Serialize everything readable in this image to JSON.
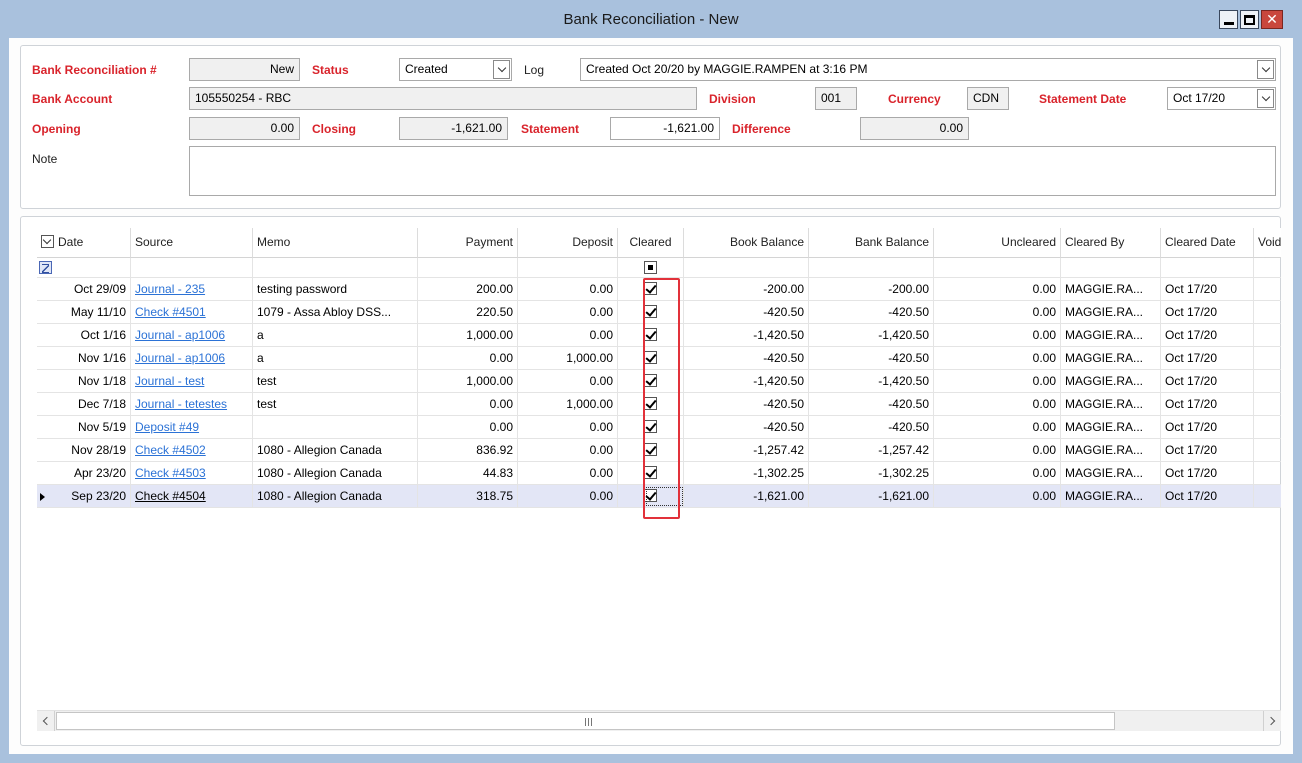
{
  "window": {
    "title": "Bank Reconciliation - New"
  },
  "header": {
    "recon_label": "Bank Reconciliation #",
    "recon_value": "New",
    "status_label": "Status",
    "status_value": "Created",
    "log_label": "Log",
    "log_value": "Created Oct 20/20 by MAGGIE.RAMPEN at 3:16 PM",
    "account_label": "Bank Account",
    "account_value": "105550254 - RBC",
    "division_label": "Division",
    "division_value": "001",
    "currency_label": "Currency",
    "currency_value": "CDN",
    "stmt_date_label": "Statement Date",
    "stmt_date_value": "Oct 17/20",
    "opening_label": "Opening",
    "opening_value": "0.00",
    "closing_label": "Closing",
    "closing_value": "-1,621.00",
    "statement_label": "Statement",
    "statement_value": "-1,621.00",
    "difference_label": "Difference",
    "difference_value": "0.00",
    "note_label": "Note",
    "note_value": ""
  },
  "grid": {
    "columns": [
      "Date",
      "Source",
      "Memo",
      "Payment",
      "Deposit",
      "Cleared",
      "Book Balance",
      "Bank Balance",
      "Uncleared",
      "Cleared By",
      "Cleared Date",
      "Void"
    ],
    "rows": [
      {
        "date": "Oct 29/09",
        "source": "Journal - 235",
        "memo": "testing password",
        "payment": "200.00",
        "deposit": "0.00",
        "cleared": true,
        "book": "-200.00",
        "bank": "-200.00",
        "uncleared": "0.00",
        "by": "MAGGIE.RA...",
        "cdate": "Oct 17/20"
      },
      {
        "date": "May 11/10",
        "source": "Check #4501",
        "memo": "1079 - Assa Abloy DSS...",
        "payment": "220.50",
        "deposit": "0.00",
        "cleared": true,
        "book": "-420.50",
        "bank": "-420.50",
        "uncleared": "0.00",
        "by": "MAGGIE.RA...",
        "cdate": "Oct 17/20"
      },
      {
        "date": "Oct 1/16",
        "source": "Journal - ap1006",
        "memo": "a",
        "payment": "1,000.00",
        "deposit": "0.00",
        "cleared": true,
        "book": "-1,420.50",
        "bank": "-1,420.50",
        "uncleared": "0.00",
        "by": "MAGGIE.RA...",
        "cdate": "Oct 17/20"
      },
      {
        "date": "Nov 1/16",
        "source": "Journal - ap1006",
        "memo": "a",
        "payment": "0.00",
        "deposit": "1,000.00",
        "cleared": true,
        "book": "-420.50",
        "bank": "-420.50",
        "uncleared": "0.00",
        "by": "MAGGIE.RA...",
        "cdate": "Oct 17/20"
      },
      {
        "date": "Nov 1/18",
        "source": "Journal - test",
        "memo": "test",
        "payment": "1,000.00",
        "deposit": "0.00",
        "cleared": true,
        "book": "-1,420.50",
        "bank": "-1,420.50",
        "uncleared": "0.00",
        "by": "MAGGIE.RA...",
        "cdate": "Oct 17/20"
      },
      {
        "date": "Dec 7/18",
        "source": "Journal - tetestes",
        "memo": "test",
        "payment": "0.00",
        "deposit": "1,000.00",
        "cleared": true,
        "book": "-420.50",
        "bank": "-420.50",
        "uncleared": "0.00",
        "by": "MAGGIE.RA...",
        "cdate": "Oct 17/20"
      },
      {
        "date": "Nov 5/19",
        "source": "Deposit #49",
        "memo": "",
        "payment": "0.00",
        "deposit": "0.00",
        "cleared": true,
        "book": "-420.50",
        "bank": "-420.50",
        "uncleared": "0.00",
        "by": "MAGGIE.RA...",
        "cdate": "Oct 17/20"
      },
      {
        "date": "Nov 28/19",
        "source": "Check #4502",
        "memo": "1080 - Allegion Canada",
        "payment": "836.92",
        "deposit": "0.00",
        "cleared": true,
        "book": "-1,257.42",
        "bank": "-1,257.42",
        "uncleared": "0.00",
        "by": "MAGGIE.RA...",
        "cdate": "Oct 17/20"
      },
      {
        "date": "Apr 23/20",
        "source": "Check #4503",
        "memo": "1080 - Allegion Canada",
        "payment": "44.83",
        "deposit": "0.00",
        "cleared": true,
        "book": "-1,302.25",
        "bank": "-1,302.25",
        "uncleared": "0.00",
        "by": "MAGGIE.RA...",
        "cdate": "Oct 17/20"
      },
      {
        "date": "Sep 23/20",
        "source": "Check #4504",
        "memo": "1080 - Allegion Canada",
        "payment": "318.75",
        "deposit": "0.00",
        "cleared": true,
        "book": "-1,621.00",
        "bank": "-1,621.00",
        "uncleared": "0.00",
        "by": "MAGGIE.RA...",
        "cdate": "Oct 17/20"
      }
    ],
    "selected_row": "Sep 23/20"
  },
  "colors": {
    "label_red": "#d9232b",
    "link_blue": "#2b72d6",
    "selected_row": "#e3e6f6",
    "highlight_box": "#e2313a",
    "title_bar": "#a9c1dd"
  },
  "icons": {
    "filter": "filter-icon",
    "row_pointer": "row-pointer-icon",
    "scroll_left": "chevron-left-icon",
    "scroll_right": "chevron-right-icon"
  }
}
